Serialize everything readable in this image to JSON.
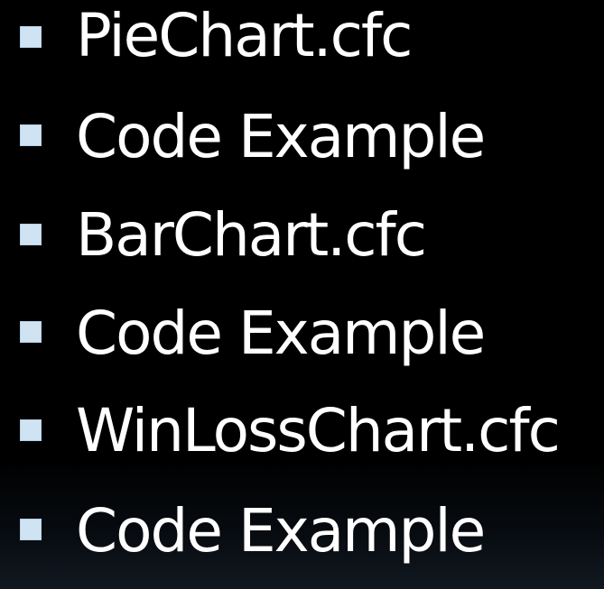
{
  "slide": {
    "bullets": [
      {
        "text": "PieChart.cfc"
      },
      {
        "text": "Code Example"
      },
      {
        "text": "BarChart.cfc"
      },
      {
        "text": "Code Example"
      },
      {
        "text": "WinLossChart.cfc"
      },
      {
        "text": "Code Example"
      }
    ],
    "colors": {
      "background": "#000000",
      "text": "#ffffff",
      "bullet": "#cfe3f3"
    }
  }
}
